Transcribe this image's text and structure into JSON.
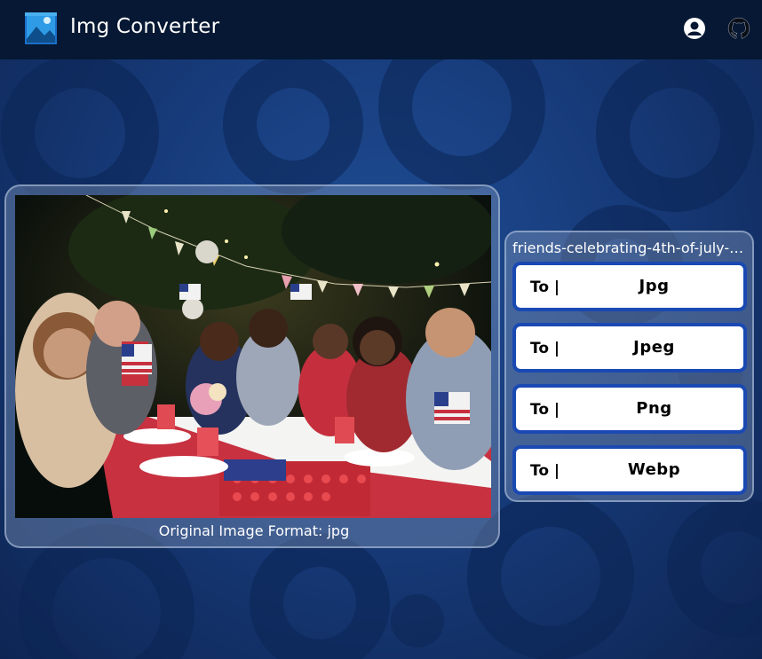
{
  "header": {
    "title": "Img Converter",
    "logo_icon": "image-gallery-icon",
    "user_icon": "account-circle-icon",
    "github_icon": "github-icon"
  },
  "preview": {
    "image_description_icon": "photo-preview",
    "format_caption": "Original Image Format: jpg"
  },
  "converter": {
    "filename": "friends-celebrating-4th-of-july-h...",
    "buttons": [
      {
        "prefix": "To |",
        "format": "Jpg"
      },
      {
        "prefix": "To |",
        "format": "Jpeg"
      },
      {
        "prefix": "To |",
        "format": "Png"
      },
      {
        "prefix": "To |",
        "format": "Webp"
      }
    ]
  },
  "colors": {
    "header_bg": "#061833",
    "page_bg": "#173b7a",
    "button_border": "#1a49b3",
    "button_bg": "#ffffff"
  }
}
